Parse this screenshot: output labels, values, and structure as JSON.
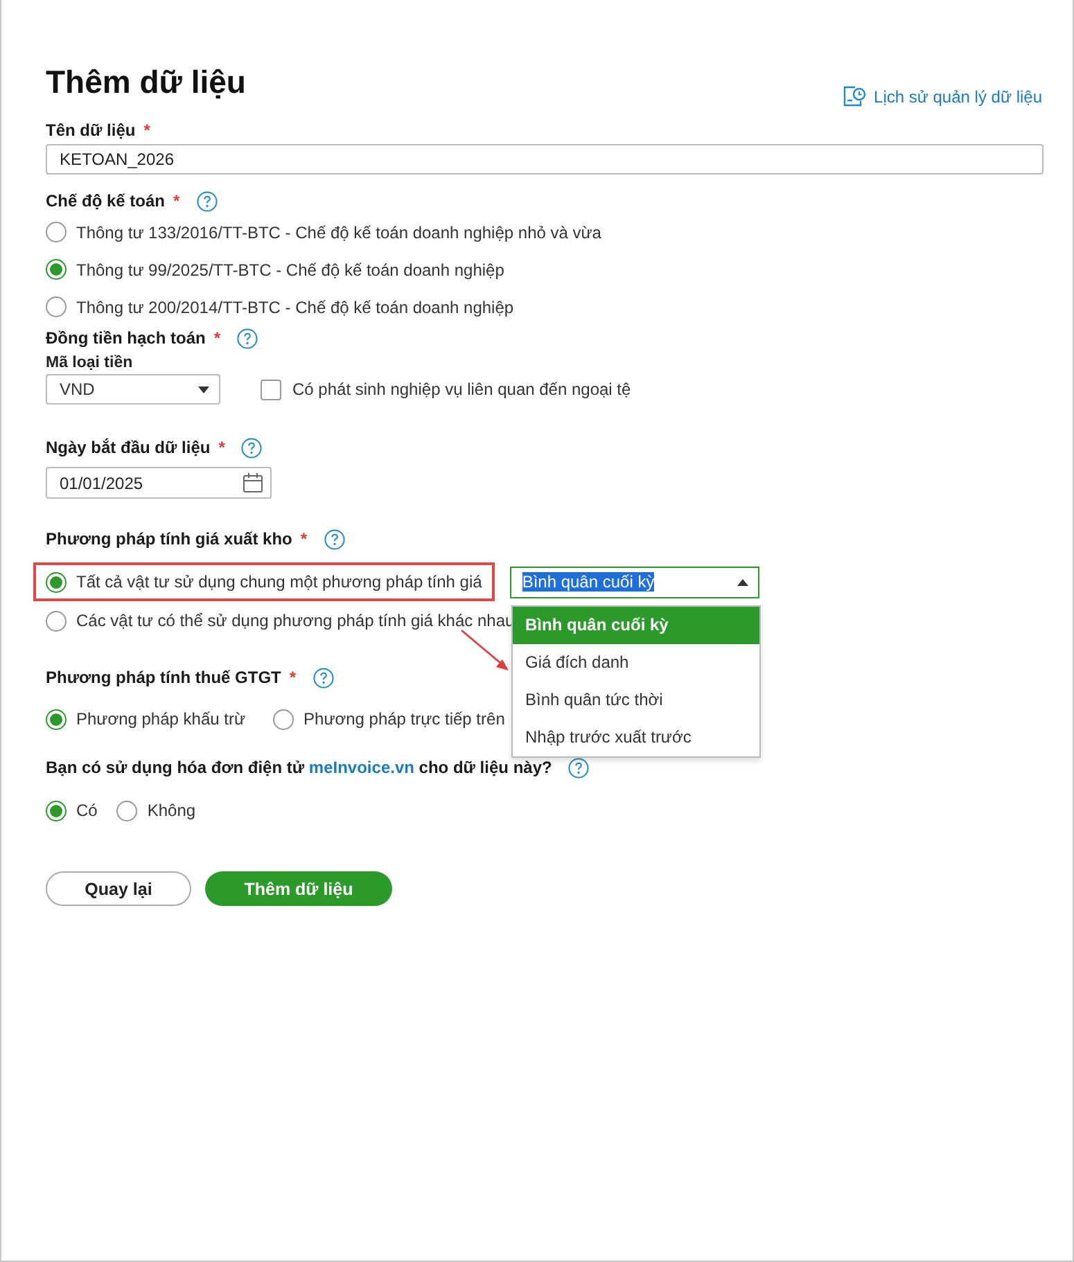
{
  "page": {
    "title": "Thêm dữ liệu",
    "history_link": "Lịch sử quản lý dữ liệu"
  },
  "name_field": {
    "label": "Tên dữ liệu",
    "required_mark": "*",
    "value": "KETOAN_2026"
  },
  "accounting_regime": {
    "label": "Chế độ kế toán",
    "required_mark": "*",
    "options": [
      {
        "label": "Thông tư 133/2016/TT-BTC - Chế độ kế toán doanh nghiệp nhỏ và vừa",
        "selected": false
      },
      {
        "label": "Thông tư 99/2025/TT-BTC - Chế độ kế toán doanh nghiệp",
        "selected": true
      },
      {
        "label": "Thông tư 200/2014/TT-BTC - Chế độ kế toán doanh nghiệp",
        "selected": false
      }
    ]
  },
  "currency": {
    "label": "Đồng tiền hạch toán",
    "required_mark": "*",
    "code_label": "Mã loại tiền",
    "code_value": "VND",
    "foreign_checkbox": {
      "label": "Có phát sinh nghiệp vụ liên quan đến ngoại tệ",
      "checked": false
    }
  },
  "start_date": {
    "label": "Ngày bắt đầu dữ liệu",
    "required_mark": "*",
    "value": "01/01/2025"
  },
  "inventory_method": {
    "label": "Phương pháp tính giá xuất kho",
    "required_mark": "*",
    "options": [
      {
        "label": "Tất cả vật tư sử dụng chung một phương pháp tính giá",
        "selected": true,
        "highlighted": true
      },
      {
        "label": "Các vật tư có thể sử dụng phương pháp tính giá khác nhau",
        "selected": false,
        "highlighted": false
      }
    ],
    "method_select": {
      "value": "Bình quân cuối kỳ",
      "expanded": true,
      "options": [
        {
          "label": "Bình quân cuối kỳ",
          "selected": true
        },
        {
          "label": "Giá đích danh",
          "selected": false
        },
        {
          "label": "Bình quân tức thời",
          "selected": false
        },
        {
          "label": "Nhập trước xuất trước",
          "selected": false
        }
      ]
    }
  },
  "vat_method": {
    "label": "Phương pháp tính thuế GTGT",
    "required_mark": "*",
    "options": [
      {
        "label": "Phương pháp khấu trừ",
        "selected": true
      },
      {
        "label": "Phương pháp trực tiếp trên",
        "selected": false
      }
    ]
  },
  "einvoice": {
    "question_before": "Bạn có sử dụng hóa đơn điện tử",
    "link": "meInvoice.vn",
    "question_after": "cho dữ liệu này?",
    "options": [
      {
        "label": "Có",
        "selected": true
      },
      {
        "label": "Không",
        "selected": false
      }
    ]
  },
  "buttons": {
    "back": "Quay lại",
    "submit": "Thêm dữ liệu"
  }
}
